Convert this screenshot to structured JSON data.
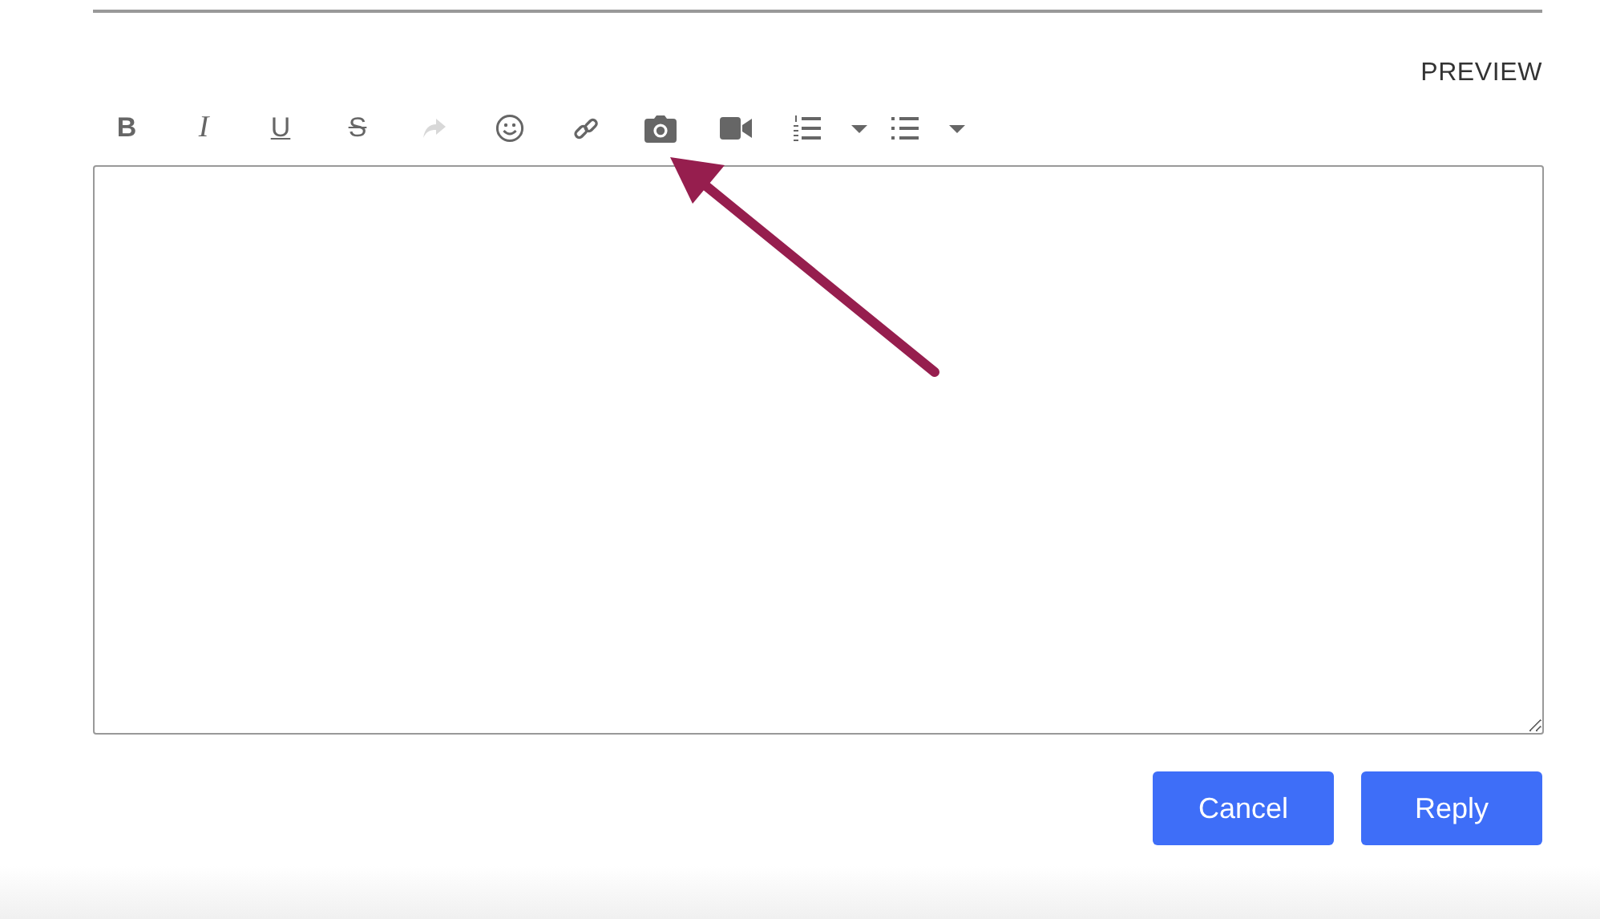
{
  "preview_link": "PREVIEW",
  "format_buttons": [
    {
      "label": "B",
      "kind": "bold"
    },
    {
      "label": "I",
      "kind": "italic"
    },
    {
      "label": "U",
      "kind": "underline"
    },
    {
      "label": "S",
      "kind": "strike"
    }
  ],
  "tool_buttons": [
    {
      "kind": "redo",
      "disabled": true
    },
    {
      "kind": "emoji",
      "disabled": false
    },
    {
      "kind": "link",
      "disabled": false
    },
    {
      "kind": "photo",
      "disabled": false
    },
    {
      "kind": "video",
      "disabled": false
    },
    {
      "kind": "numbered-list",
      "disabled": false
    },
    {
      "kind": "bullet-list",
      "disabled": false
    }
  ],
  "buttons": [
    {
      "label": "Cancel"
    },
    {
      "label": "Reply"
    }
  ]
}
